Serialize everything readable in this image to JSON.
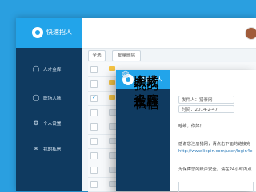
{
  "app": {
    "brand_title": "快速招人"
  },
  "back": {
    "nav": [
      {
        "label": "人才金库",
        "icon": "person-icon"
      },
      {
        "label": "职场人脉",
        "icon": "group-icon"
      },
      {
        "label": "个人设置",
        "icon": "gear-icon"
      },
      {
        "label": "我的私信",
        "icon": "mail-icon"
      }
    ],
    "toolbar": {
      "select_all": "全选",
      "delete_selected": "批量删除"
    },
    "rows": [
      {
        "checked": false,
        "unread": true
      },
      {
        "checked": false,
        "unread": true
      },
      {
        "checked": true,
        "unread": true
      },
      {
        "checked": false,
        "unread": false
      },
      {
        "checked": false,
        "unread": false
      },
      {
        "checked": false,
        "unread": false
      },
      {
        "checked": false,
        "unread": false
      },
      {
        "checked": false,
        "unread": false
      },
      {
        "checked": false,
        "unread": false
      }
    ]
  },
  "front": {
    "nav": [
      {
        "label": "人才金库",
        "icon": "person-icon"
      },
      {
        "label": "职场人脉",
        "icon": "group-icon"
      },
      {
        "label": "个人设置",
        "icon": "gear-icon"
      },
      {
        "label": "我的私信",
        "icon": "mail-icon"
      }
    ],
    "message": {
      "sender": "发件人：猎泰网",
      "time": "时间：2014-2-47",
      "greeting": "晗维，你好！",
      "body1": "感谢您注册猎网，请点击下面的链接完",
      "link": "http://www.liepin.com/user/login4e",
      "body2": "为保障您的账户安全，请在24小时内点"
    }
  },
  "colors": {
    "accent": "#22a4ea",
    "sidebar": "#0f3a60",
    "background": "#2a9fe0",
    "unread": "#f6c444"
  }
}
